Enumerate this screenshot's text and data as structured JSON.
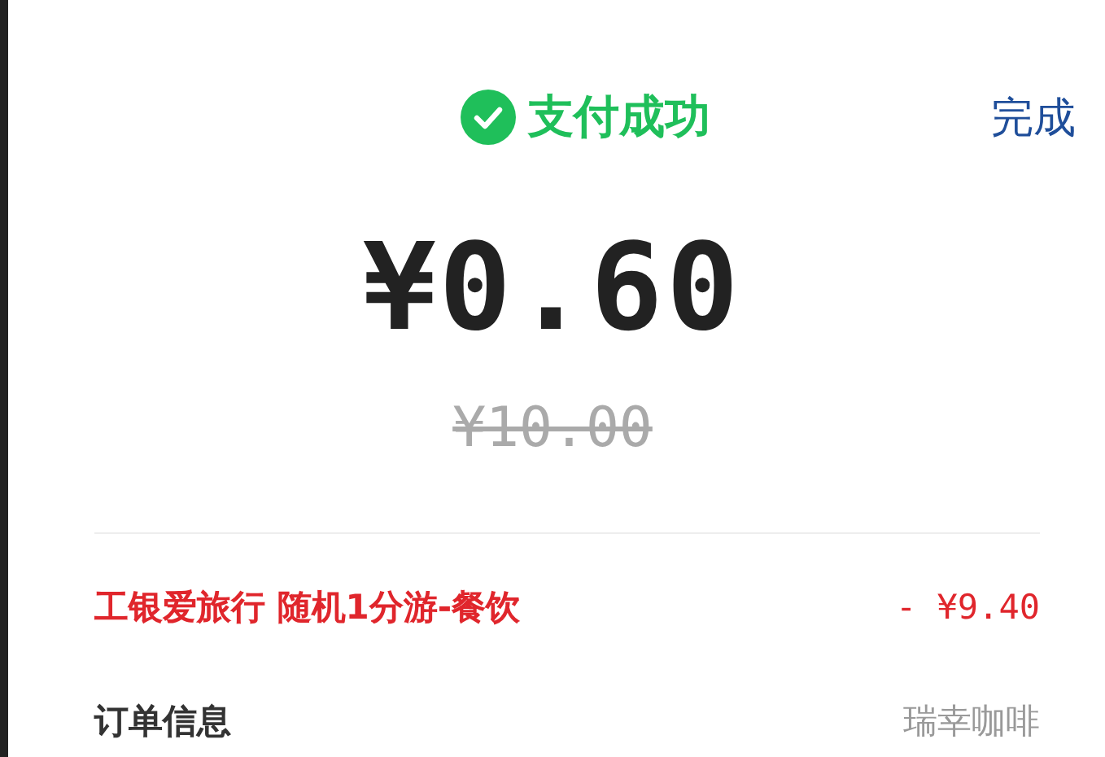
{
  "header": {
    "status": "支付成功",
    "done": "完成"
  },
  "amount": "¥0.60",
  "original_price": "¥10.00",
  "discount": {
    "label": "工银爱旅行 随机1分游-餐饮",
    "value": "- ¥9.40"
  },
  "order": {
    "label": "订单信息",
    "merchant": "瑞幸咖啡"
  }
}
